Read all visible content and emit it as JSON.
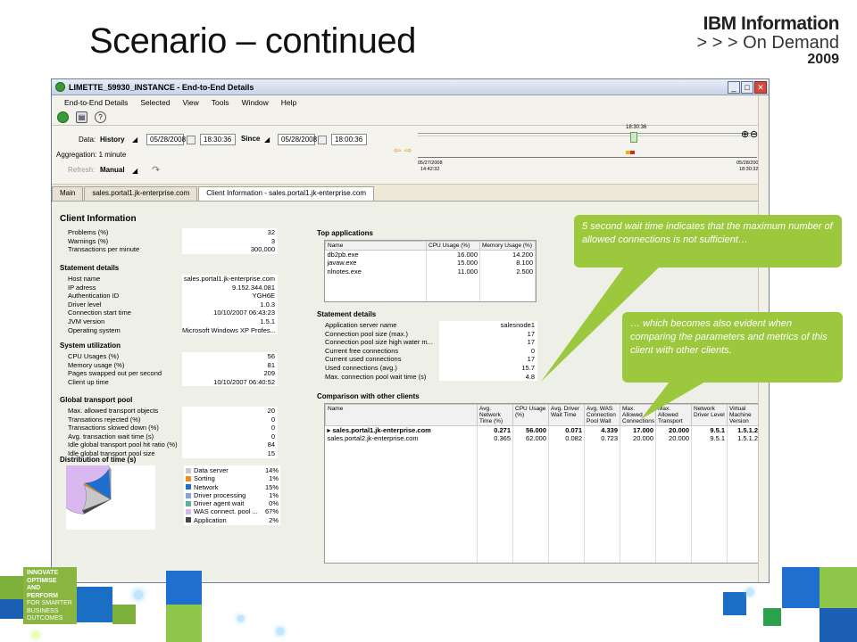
{
  "slide": {
    "title": "Scenario – continued",
    "logo_line1": "IBM Information",
    "logo_line2": "> > >  On Demand",
    "logo_line3": "2009",
    "tagline": [
      "INNOVATE",
      "OPTIMISE",
      "AND PERFORM",
      "FOR SMARTER",
      "BUSINESS",
      "OUTCOMES"
    ]
  },
  "window": {
    "title": "LIMETTE_59930_INSTANCE - End-to-End Details",
    "menu": [
      "End-to-End Details",
      "Selected",
      "View",
      "Tools",
      "Window",
      "Help"
    ],
    "data_label": "Data:",
    "data_mode": "History",
    "from_date": "05/28/2008",
    "from_time": "18:30:36",
    "since_label": "Since",
    "to_date": "05/28/2008",
    "to_time": "18:00:36",
    "aggregation": "Aggregation:  1 minute",
    "refresh_label": "Refresh:",
    "refresh_mode": "Manual",
    "timeline_top": "18:30:36",
    "timeline_left_date": "05/27/2008",
    "timeline_left_time": "14:42:32",
    "timeline_right_date": "05/28/200",
    "timeline_right_time": "18:30:32",
    "tabs": [
      "Main",
      "sales.portal1.jk-enterprise.com",
      "Client Information - sales.portal1.jk-enterprise.com"
    ]
  },
  "client_info": {
    "title": "Client Information",
    "summary": [
      {
        "k": "Problems (%)",
        "v": "32"
      },
      {
        "k": "Warnings (%)",
        "v": "3"
      },
      {
        "k": "Transactions per minute",
        "v": "300,000"
      }
    ],
    "statement_details_title": "Statement details",
    "statement_details": [
      {
        "k": "Host name",
        "v": "sales.portal1.jk-enterprise.com"
      },
      {
        "k": "IP adress",
        "v": "9.152.344.081"
      },
      {
        "k": "Authentication ID",
        "v": "YGH6E"
      },
      {
        "k": "Driver level",
        "v": "1.0.3"
      },
      {
        "k": "Connection start time",
        "v": "10/10/2007 06:43:23"
      },
      {
        "k": "JVM version",
        "v": "1.5.1"
      },
      {
        "k": "Operating system",
        "v": "Microsoft Windows XP Profes..."
      }
    ],
    "system_utilization_title": "System utilization",
    "system_utilization": [
      {
        "k": "CPU Usages (%)",
        "v": "56"
      },
      {
        "k": "Memory usage (%)",
        "v": "81"
      },
      {
        "k": "Pages swapped out per second",
        "v": "209"
      },
      {
        "k": "Client up time",
        "v": "10/10/2007 06:40:52"
      }
    ],
    "global_pool_title": "Global transport pool",
    "global_pool": [
      {
        "k": "Max. allowed transport objects",
        "v": "20"
      },
      {
        "k": "Transations rejected (%)",
        "v": "0"
      },
      {
        "k": "Transactions slowed down (%)",
        "v": "0"
      },
      {
        "k": "Avg. transaction wait time (s)",
        "v": "0"
      },
      {
        "k": "Idle global transport pool hit ratio (%)",
        "v": "84"
      },
      {
        "k": "Idle global transport pool size",
        "v": "15"
      }
    ],
    "distribution_title": "Distribution of time (s)"
  },
  "chart_data": {
    "type": "pie",
    "categories": [
      "Data server",
      "Sorting",
      "Network",
      "Driver processing",
      "Driver agent wait",
      "WAS connect. pool ...",
      "Application"
    ],
    "values": [
      14,
      1,
      15,
      1,
      0,
      67,
      2
    ],
    "labels": [
      "14%",
      "1%",
      "15%",
      "1%",
      "0%",
      "67%",
      "2%"
    ],
    "colors": [
      "#c8c8c8",
      "#f08a1c",
      "#1c6fd1",
      "#7fa6d8",
      "#5db0a0",
      "#d9b8ef",
      "#444444"
    ],
    "title": "Distribution of time (s)"
  },
  "top_apps": {
    "title": "Top applications",
    "headers": [
      "Name",
      "CPU Usage (%)",
      "Memory Usage (%)"
    ],
    "rows": [
      [
        "db2pb.exe",
        "16.000",
        "14.200"
      ],
      [
        "javaw.exe",
        "15.000",
        "8.100"
      ],
      [
        "nlnotes.exe",
        "11.000",
        "2.500"
      ]
    ]
  },
  "stmt_details2": {
    "title": "Statement details",
    "rows": [
      {
        "k": "Application server name",
        "v": "salesnode1"
      },
      {
        "k": "Connection pool size (max.)",
        "v": "17"
      },
      {
        "k": "Connection pool size high water m...",
        "v": "17"
      },
      {
        "k": "Current free connections",
        "v": "0"
      },
      {
        "k": "Current used connections",
        "v": "17"
      },
      {
        "k": "Used connections (avg.)",
        "v": "15.7"
      },
      {
        "k": "Max. connection pool wait time (s)",
        "v": "4.8"
      }
    ]
  },
  "comparison": {
    "title": "Comparison with other clients",
    "headers": [
      "Name",
      "Avg. Network Time (%)",
      "CPU Usage (%)",
      "Avg. Driver Wait Time",
      "Avg. WAS Connection Pool Wait",
      "Max. Allowed Connections",
      "Max. Allowed Transport",
      "Network Driver Level",
      "Virtual Machine Version"
    ],
    "rows": [
      [
        "sales.portal1.jk-enterprise.com",
        "0.271",
        "56.000",
        "0.071",
        "4.339",
        "17.000",
        "20.000",
        "9.5.1",
        "1.5.1.2"
      ],
      [
        "sales.portal2.jk-enterprise.com",
        "0.365",
        "62.000",
        "0.082",
        "0.723",
        "20.000",
        "20.000",
        "9.5.1",
        "1.5.1.2"
      ]
    ]
  },
  "callouts": {
    "c1": "5 second wait time indicates that the maximum number of allowed connections is not sufficient…",
    "c2": "… which becomes also evident when comparing the parameters and metrics of this client with other clients."
  }
}
